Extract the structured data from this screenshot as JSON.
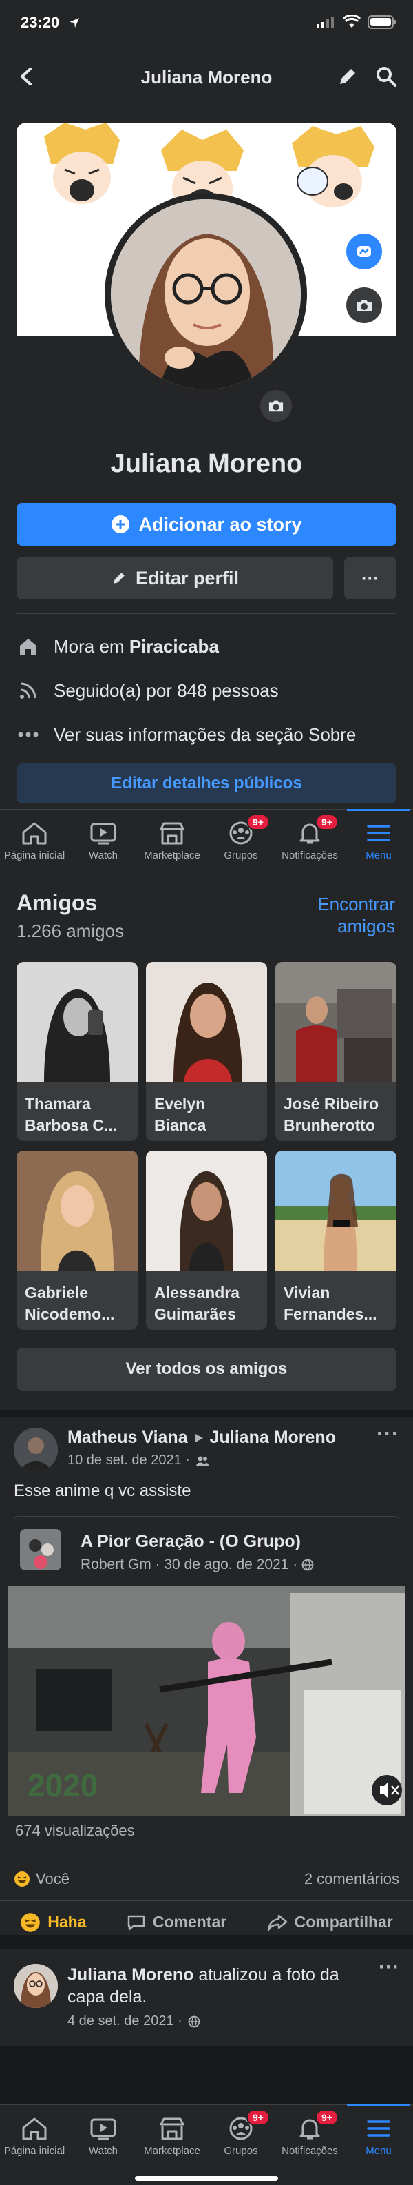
{
  "status_bar": {
    "time": "23:20"
  },
  "header": {
    "title": "Juliana Moreno"
  },
  "profile": {
    "name": "Juliana Moreno",
    "add_story_label": "Adicionar ao story",
    "edit_profile_label": "Editar perfil",
    "more_label": "···",
    "info": [
      {
        "icon": "home-icon",
        "prefix": "Mora em ",
        "value": "Piracicaba"
      },
      {
        "icon": "rss-icon",
        "prefix": "Seguido(a) por 848 pessoas",
        "value": ""
      },
      {
        "icon": "more-dots-icon",
        "prefix": "Ver suas informações da seção Sobre",
        "value": ""
      }
    ],
    "edit_public_label": "Editar detalhes públicos"
  },
  "tabbar": {
    "tabs": [
      {
        "label": "Página inicial",
        "icon": "home-icon"
      },
      {
        "label": "Watch",
        "icon": "watch-icon"
      },
      {
        "label": "Marketplace",
        "icon": "marketplace-icon"
      },
      {
        "label": "Grupos",
        "icon": "groups-icon",
        "badge": "9+"
      },
      {
        "label": "Notificações",
        "icon": "bell-icon",
        "badge": "9+"
      },
      {
        "label": "Menu",
        "icon": "menu-icon",
        "active": true
      }
    ]
  },
  "friends": {
    "title": "Amigos",
    "count": "1.266 amigos",
    "find_label_1": "Encontrar",
    "find_label_2": "amigos",
    "list": [
      {
        "line1": "Thamara",
        "line2": "Barbosa C..."
      },
      {
        "line1": "Evelyn",
        "line2": "Bianca"
      },
      {
        "line1": "José Ribeiro",
        "line2": "Brunherotto"
      },
      {
        "line1": "Gabriele",
        "line2": "Nicodemo..."
      },
      {
        "line1": "Alessandra",
        "line2": "Guimarães"
      },
      {
        "line1": "Vivian",
        "line2": "Fernandes..."
      }
    ],
    "see_all_label": "Ver todos os amigos"
  },
  "post": {
    "author": "Matheus Viana",
    "target": "Juliana Moreno",
    "date": "10 de set. de 2021 ·",
    "text": "Esse anime q vc assiste",
    "shared": {
      "group": "A Pior Geração - (O Grupo)",
      "meta": "Robert Gm · 30 de ago. de 2021 ·"
    },
    "views": "674 visualizações",
    "reaction_label": "Você",
    "comments": "2 comentários",
    "actions": {
      "haha": "Haha",
      "comment": "Comentar",
      "share": "Compartilhar"
    },
    "video_overlay": "2020"
  },
  "post2": {
    "author": "Juliana Moreno",
    "text": " atualizou a foto da capa dela.",
    "date": "4 de set. de 2021 ·"
  },
  "colors": {
    "accent": "#2d88ff",
    "badge": "#e41e3f",
    "haha": "#f7b928"
  }
}
